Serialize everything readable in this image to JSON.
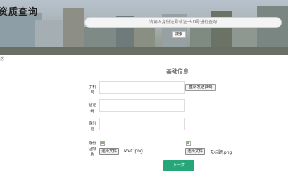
{
  "banner": {
    "title": "资质查询",
    "search_placeholder": "请输入身份证号或证书ID号进行查询",
    "search_button": "搜索"
  },
  "page": {
    "corner_label": "返"
  },
  "form": {
    "section_title": "基础信息",
    "phone_label": "手机号",
    "resend_button": "重新发送(36)",
    "code_label": "验证码",
    "id_label": "身份证",
    "photo_label": "身份证照片",
    "file1": {
      "button": "选择文件",
      "filename": "MVC.png"
    },
    "file2": {
      "button": "选择文件",
      "filename": "无标题.png"
    },
    "next_button": "下一步"
  },
  "colors": {
    "primary": "#27a67a"
  }
}
